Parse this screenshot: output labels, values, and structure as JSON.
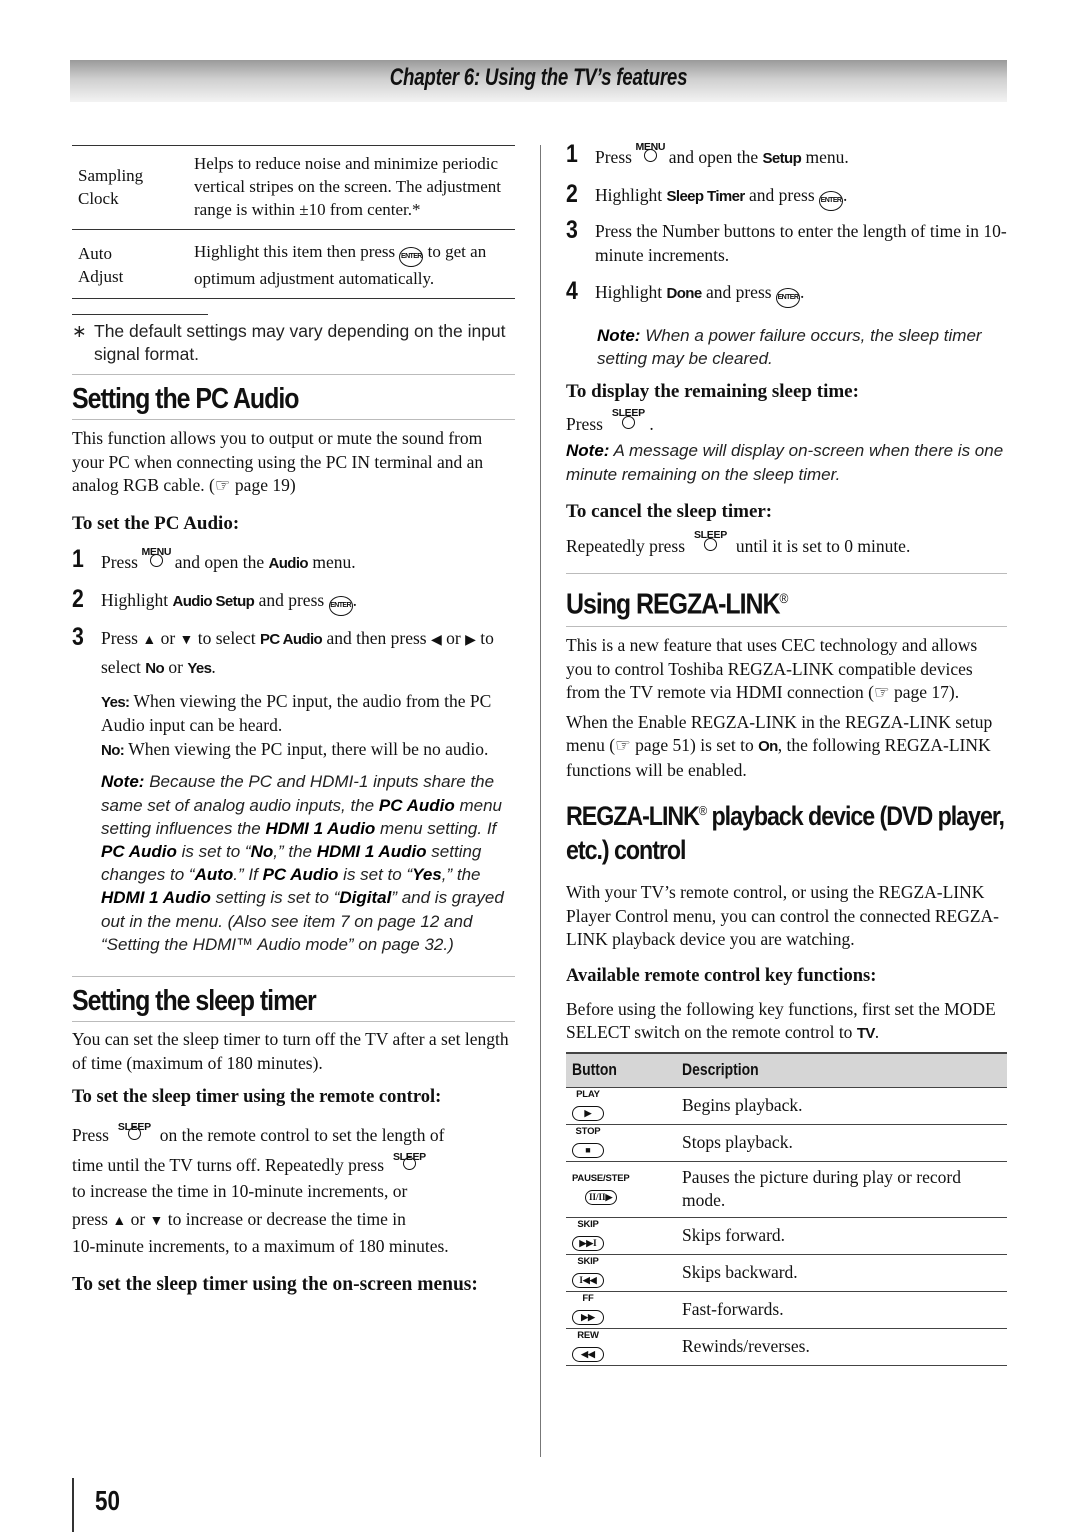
{
  "header": {
    "title": "Chapter 6: Using the TV’s features"
  },
  "left": {
    "spec_table": [
      {
        "label": "Sampling Clock",
        "desc": "Helps to reduce noise and minimize periodic vertical stripes on the screen. The adjustment range is within ±10 from center.*"
      },
      {
        "label": "Auto Adjust",
        "desc_pre": "Highlight this item then press",
        "desc_post": "to get an optimum adjustment automatically."
      }
    ],
    "footnote_mark": "∗",
    "footnote": "The default settings may vary depending on the input signal format.",
    "pc_audio": {
      "title": "Setting the PC Audio",
      "intro": "This function allows you to output or mute the sound from your PC when connecting using the PC IN terminal and an analog RGB cable. (☞ page 19)",
      "subhead": "To set the PC Audio:",
      "steps": [
        {
          "num": "1",
          "pre": "Press",
          "key": "MENU",
          "mid": "and open the",
          "bold": "Audio",
          "post": "menu."
        },
        {
          "num": "2",
          "pre": "Highlight",
          "bold": "Audio Setup",
          "post": "and press"
        },
        {
          "num": "3",
          "pre": "Press",
          "up": "▲",
          "or1": "or",
          "down": "▼",
          "mid": "to select",
          "bold": "PC Audio",
          "post": "and then press",
          "left": "◀",
          "or2": "or",
          "right": "▶",
          "mid2": "to select",
          "bold2": "No",
          "or3": "or",
          "bold3": "Yes"
        }
      ],
      "yes_label": "Yes:",
      "yes_text": "When viewing the PC input, the audio from the PC Audio input can be heard.",
      "no_label": "No:",
      "no_text": "When viewing the PC input, there will be no audio.",
      "note_label": "Note:",
      "note_html_parts": [
        "Because the PC and HDMI-1 inputs share the same set of analog audio inputs, the ",
        "PC Audio",
        " menu setting influences the ",
        "HDMI 1 Audio",
        " menu setting. If ",
        "PC Audio",
        " is set to “",
        "No",
        ",” the ",
        "HDMI 1 Audio",
        " setting changes to “",
        "Auto",
        ".” If ",
        "PC Audio",
        " is set to “",
        "Yes",
        ",” the ",
        "HDMI 1 Audio",
        " setting is set to “",
        "Digital",
        "” and is grayed out in the menu. (Also see item 7 on page 12 and “Setting the HDMI™ Audio mode” on page 32.)"
      ]
    },
    "sleep": {
      "title": "Setting the sleep timer",
      "intro": "You can set the sleep timer to turn off the TV after a set length of time (maximum of 180 minutes).",
      "subhead_remote": "To set the sleep timer using the remote control:",
      "remote_p1_pre": "Press",
      "key": "SLEEP",
      "remote_p1_post": "on the remote control to set the length of",
      "remote_p2_pre": "time until the TV turns off. Repeatedly press",
      "remote_p3": "to increase the time in 10-minute increments, or",
      "remote_p4_pre": "press",
      "remote_p4_up": "▲",
      "remote_p4_or": "or",
      "remote_p4_down": "▼",
      "remote_p4_post": "to increase or decrease the time in",
      "remote_p5": "10-minute increments, to a maximum of 180 minutes.",
      "subhead_menus": "To set the sleep timer using the on-screen menus:"
    }
  },
  "right": {
    "steps": [
      {
        "num": "1",
        "pre": "Press",
        "key": "MENU",
        "mid": "and open the",
        "bold": "Setup",
        "post": "menu."
      },
      {
        "num": "2",
        "pre": "Highlight",
        "bold": "Sleep Timer",
        "post": "and press"
      },
      {
        "num": "3",
        "text": "Press the Number buttons to enter the length of time in 10-minute increments."
      },
      {
        "num": "4",
        "pre": "Highlight",
        "bold": "Done",
        "post": "and press"
      }
    ],
    "note1_label": "Note:",
    "note1": "When a power failure occurs, the sleep timer setting may be cleared.",
    "display_head": "To display the remaining sleep time:",
    "display_pre": "Press",
    "key_sleep": "SLEEP",
    "note2_label": "Note:",
    "note2": "A message will display on-screen when there is one minute remaining on the sleep timer.",
    "cancel_head": "To cancel the sleep timer:",
    "cancel_pre": "Repeatedly press",
    "cancel_post": "until it is set to 0 minute.",
    "regza": {
      "title": "Using REGZA-LINK",
      "reg": "®",
      "p1": "This is a new feature that uses CEC technology and allows you to control Toshiba REGZA-LINK compatible devices from the TV remote via HDMI connection (☞ page 17).",
      "p2_pre": "When the Enable REGZA-LINK in the REGZA-LINK setup menu (☞ page 51) is set to",
      "p2_bold": "On",
      "p2_post": ", the following REGZA-LINK functions will be enabled.",
      "h3_a": "REGZA-LINK",
      "h3_b": " playback device (DVD player, etc.) control",
      "p3": "With your TV’s remote control, or using the REGZA-LINK Player Control menu, you can control the connected REGZA-LINK playback device you are watching.",
      "keys_head": "Available remote control key functions:",
      "p4_pre": "Before using the following key functions, first set the MODE SELECT switch on the remote control to",
      "p4_bold": "TV",
      "table": {
        "headers": [
          "Button",
          "Description"
        ],
        "rows": [
          {
            "key": "PLAY",
            "glyph": "▶",
            "desc": "Begins playback."
          },
          {
            "key": "STOP",
            "glyph": "■",
            "desc": "Stops playback."
          },
          {
            "key": "PAUSE/STEP",
            "glyph": "II/II▶",
            "desc": "Pauses the picture during play or record mode."
          },
          {
            "key": "SKIP",
            "glyph": "▶▶I",
            "desc": "Skips forward."
          },
          {
            "key": "SKIP",
            "glyph": "I◀◀",
            "desc": "Skips backward."
          },
          {
            "key": "FF",
            "glyph": "▶▶",
            "desc": "Fast-forwards."
          },
          {
            "key": "REW",
            "glyph": "◀◀",
            "desc": "Rewinds/reverses."
          }
        ]
      }
    }
  },
  "footer": {
    "page_number": "50"
  }
}
